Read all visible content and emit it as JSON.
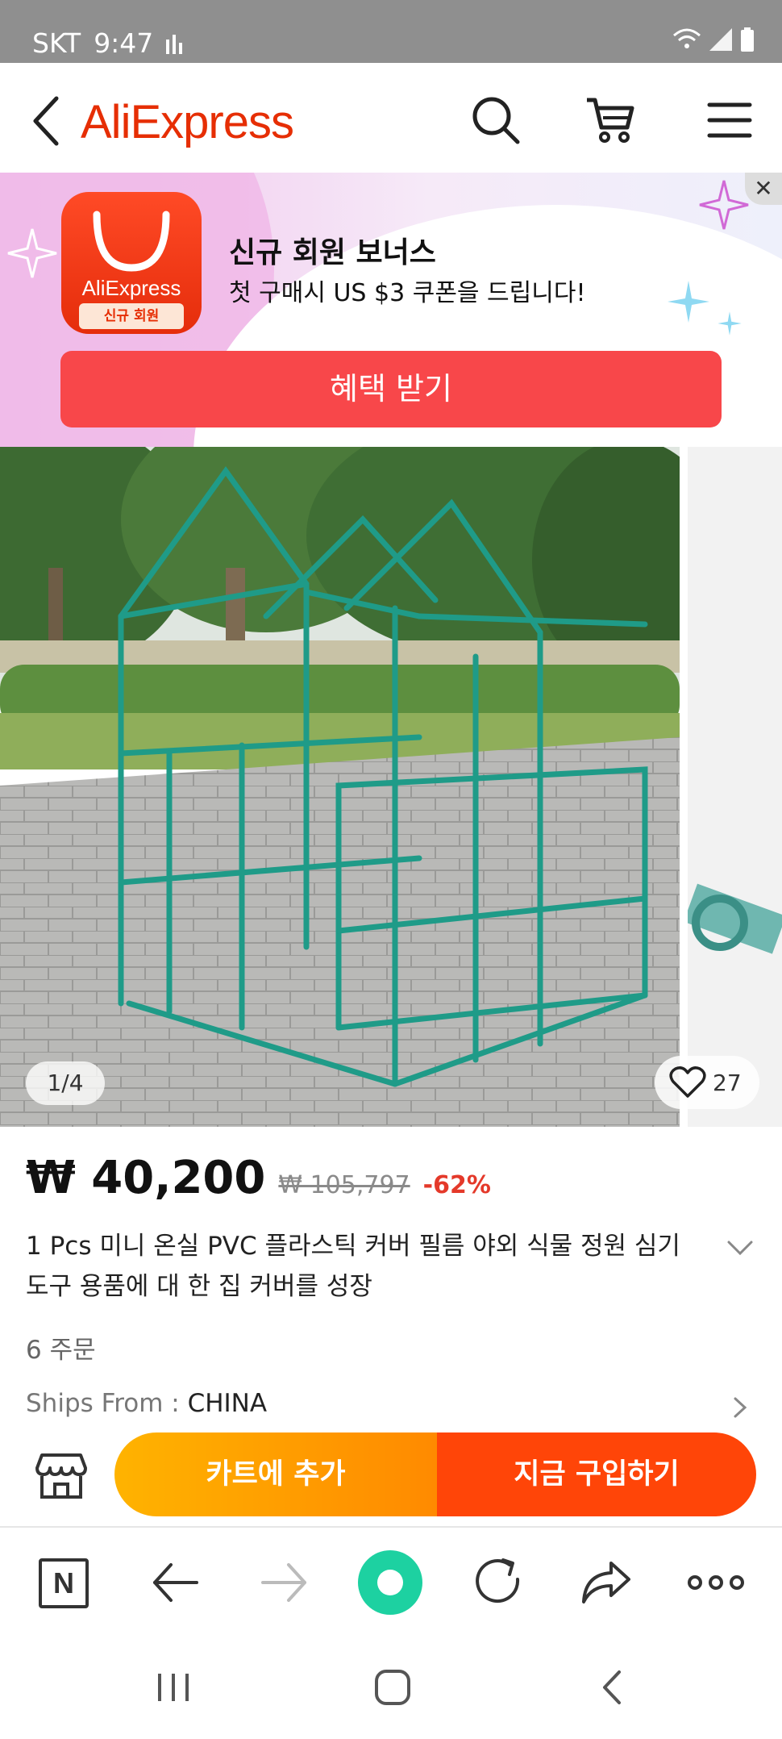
{
  "status": {
    "carrier": "SKT",
    "time": "9:47"
  },
  "header": {
    "logo": "AliExpress"
  },
  "promo": {
    "app_name": "AliExpress",
    "app_tag": "신규 회원",
    "title": "신규 회원 보너스",
    "subtitle": "첫 구매시 US $3 쿠폰을 드립니다!",
    "cta": "혜택 받기"
  },
  "gallery": {
    "counter": "1/4",
    "wish_count": "27"
  },
  "product": {
    "price": "₩ 40,200",
    "original_price": "₩ 105,797",
    "discount": "-62%",
    "title": "1 Pcs 미니 온실 PVC 플라스틱 커버 필름 야외 식물 정원 심기 도구 용품에 대 한 집 커버를 성장",
    "orders": "6 주문",
    "ships_from_label": "Ships From : ",
    "ships_from_value": "CHINA"
  },
  "actions": {
    "add_to_cart": "카트에 추가",
    "buy_now": "지금 구입하기"
  },
  "browser": {
    "n_label": "N"
  },
  "colors": {
    "brand": "#e62e04",
    "cta_red": "#f8474a",
    "cart_orange": "#ffa000",
    "buy_red": "#ff4508",
    "discount": "#e4392a"
  }
}
